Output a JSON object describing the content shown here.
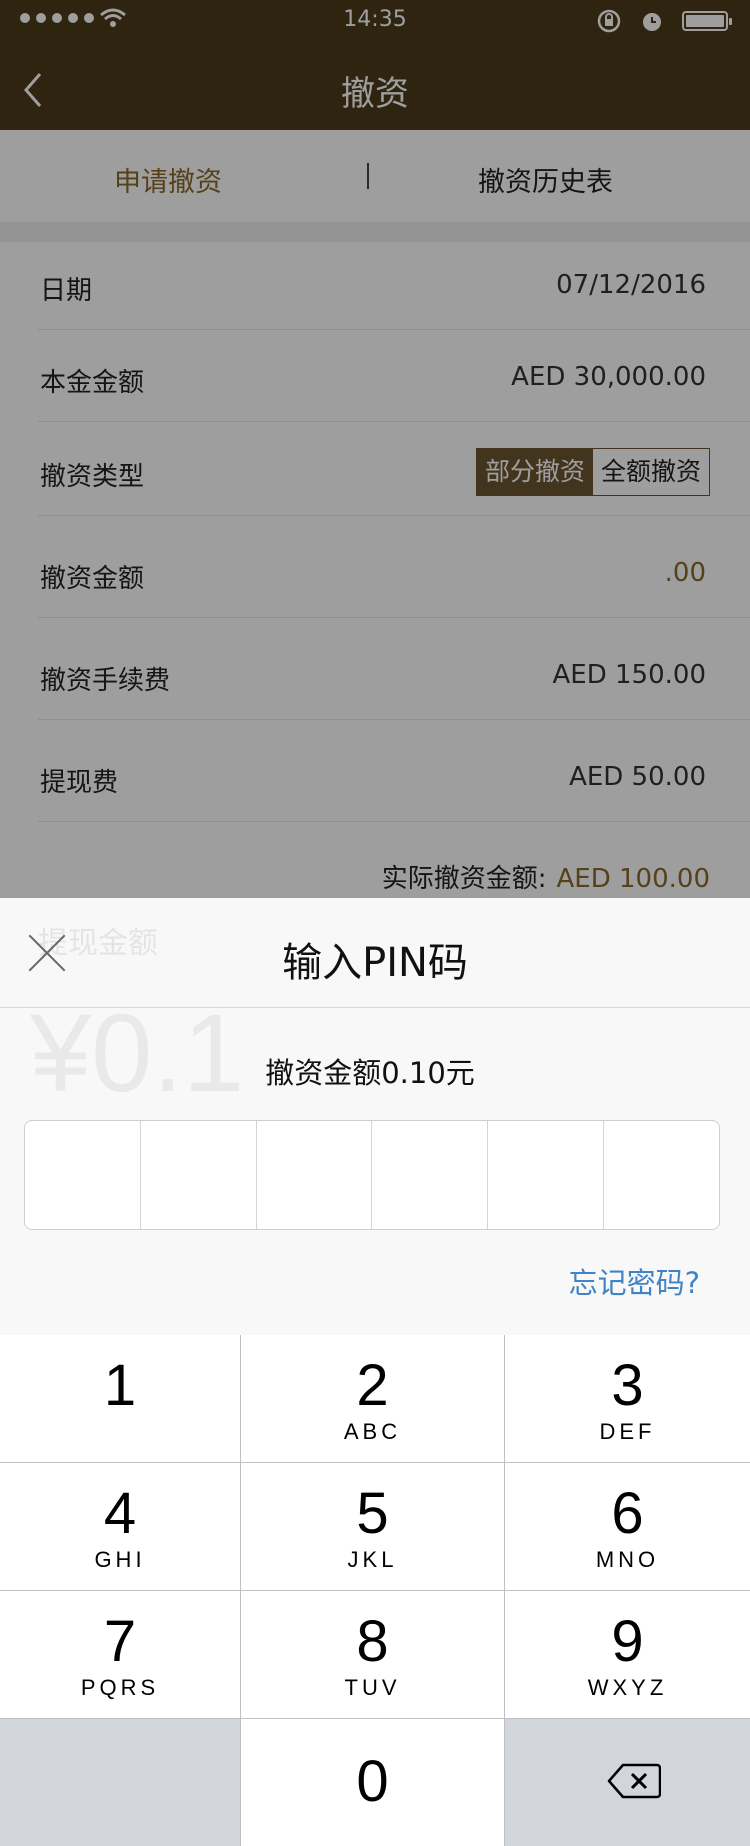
{
  "status_bar": {
    "time": "14:35"
  },
  "nav": {
    "title": "撤资"
  },
  "tabs": {
    "apply": "申请撤资",
    "history": "撤资历史表"
  },
  "form": {
    "rows": [
      {
        "label": "日期",
        "value": "07/12/2016"
      },
      {
        "label": "本金金额",
        "value": "AED 30,000.00"
      },
      {
        "label": "撤资类型",
        "options": [
          "部分撤资",
          "全额撤资"
        ],
        "selected": "部分撤资"
      },
      {
        "label": "撤资金额",
        "value": ".00"
      },
      {
        "label": "撤资手续费",
        "value": "AED 150.00"
      },
      {
        "label": "提现费",
        "value": "AED 50.00"
      }
    ],
    "actual_label": "实际撤资金额:",
    "actual_value": "AED 100.00",
    "behind_label": "提现金额",
    "behind_amount": "¥0.1"
  },
  "pin_sheet": {
    "title": "输入PIN码",
    "subtitle": "撤资金额0.10元",
    "forgot": "忘记密码?",
    "digits_count": 6
  },
  "keypad": {
    "keys": [
      {
        "num": "1",
        "letters": ""
      },
      {
        "num": "2",
        "letters": "ABC"
      },
      {
        "num": "3",
        "letters": "DEF"
      },
      {
        "num": "4",
        "letters": "GHI"
      },
      {
        "num": "5",
        "letters": "JKL"
      },
      {
        "num": "6",
        "letters": "MNO"
      },
      {
        "num": "7",
        "letters": "PQRS"
      },
      {
        "num": "8",
        "letters": "TUV"
      },
      {
        "num": "9",
        "letters": "WXYZ"
      },
      {
        "num": "0",
        "letters": ""
      }
    ]
  },
  "colors": {
    "brand": "#4d3a1a",
    "accent": "#8a6a2a",
    "link": "#3f84c8"
  }
}
